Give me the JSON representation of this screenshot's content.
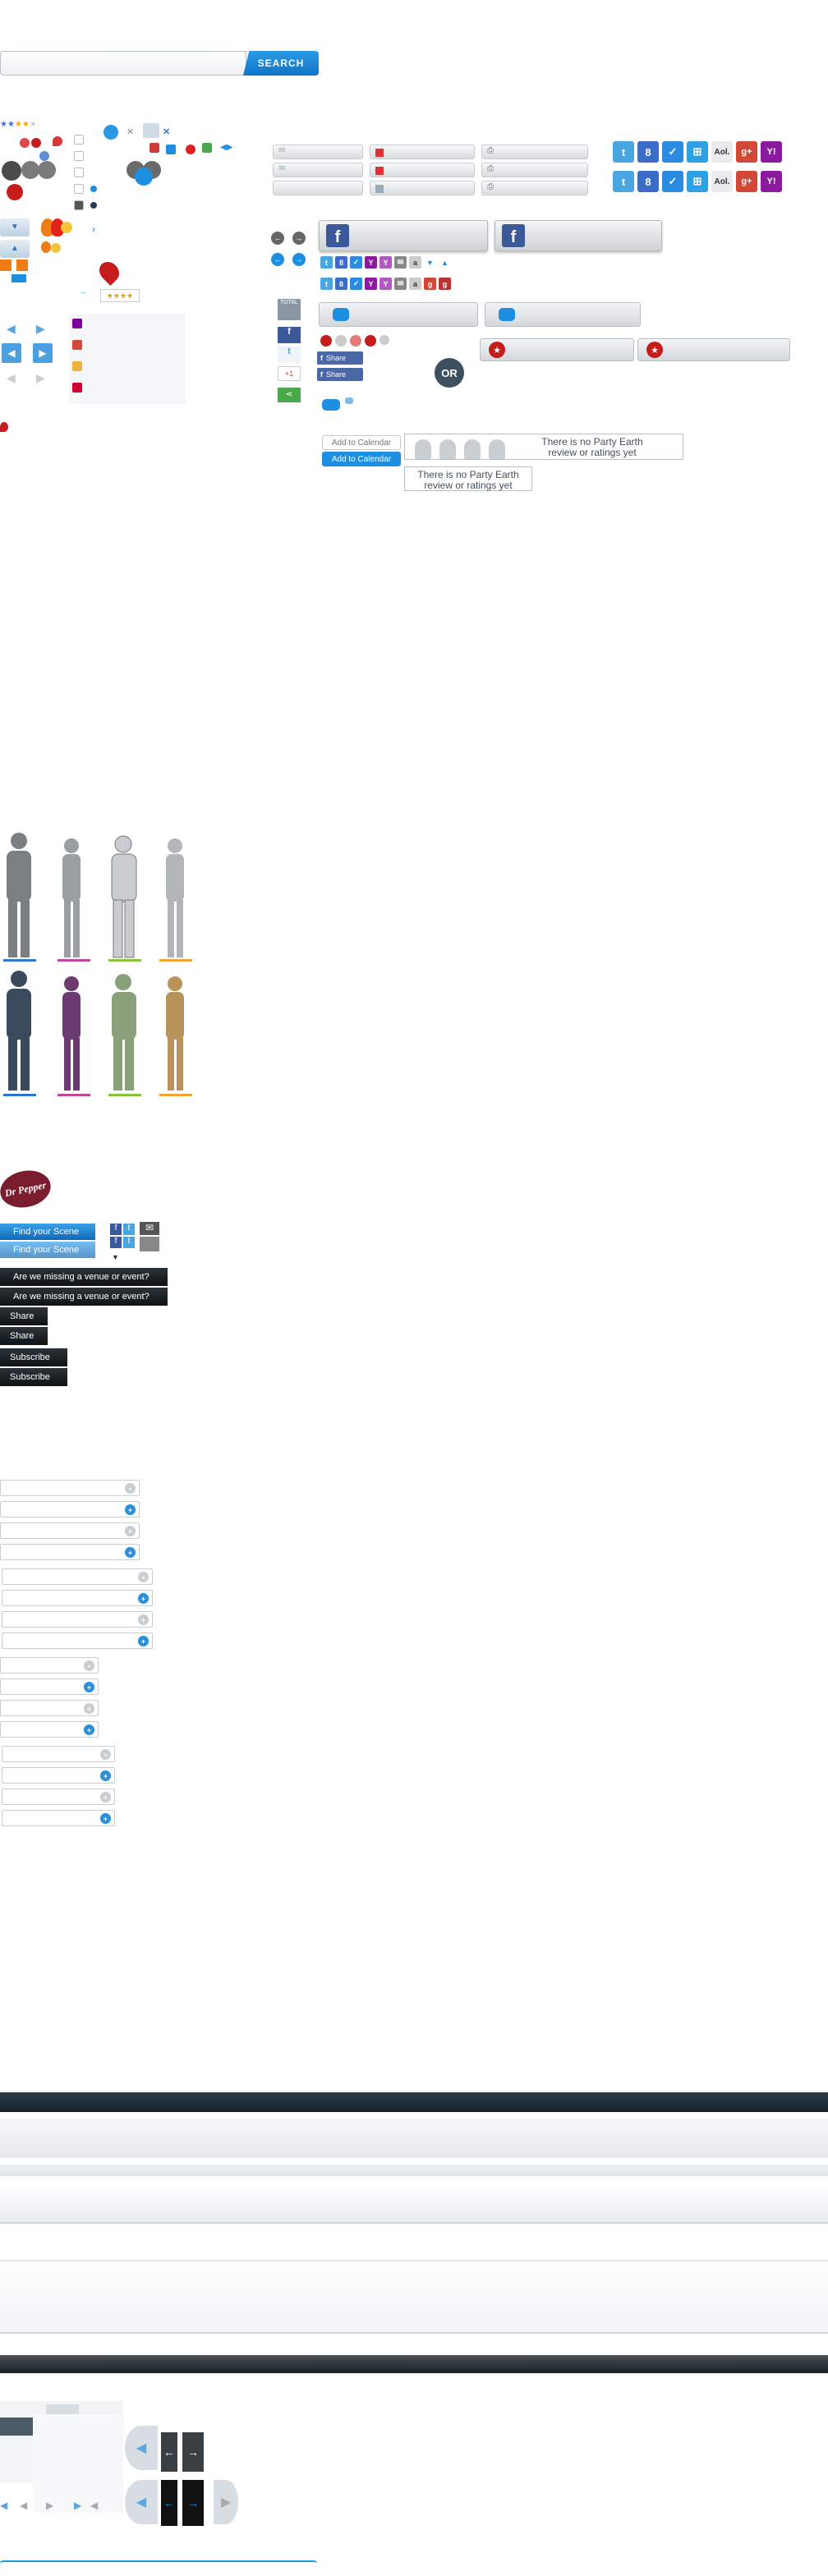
{
  "search": {
    "placeholder": "",
    "button_label": "SEARCH"
  },
  "colors": {
    "accent_blue": "#1e8fe0",
    "facebook": "#3b5998",
    "twitter": "#4aa6e0",
    "red": "#c51c1c",
    "green": "#49a84a",
    "dark": "#1f2a32"
  },
  "rating": {
    "stars_filled": 4,
    "stars_total": 5
  },
  "social": {
    "aol_label": "Aol.",
    "yahoo_label": "Y!",
    "google_plus_label": "g+",
    "facebook_letter": "f",
    "google_letter": "8",
    "twitter_letter": "t",
    "windows_label": "⊞"
  },
  "share": {
    "total_label": "TOTAL",
    "share_label": "Share",
    "gplus_label": "+1"
  },
  "or_label": "OR",
  "calendar": {
    "add_label": "Add to Calendar",
    "add_label_active": "Add to Calendar"
  },
  "messages": {
    "no_review_1": "There is no Party Earth review or ratings yet",
    "no_review_2": "There is no Party Earth review or ratings yet"
  },
  "brand": {
    "logo_text": "Dr Pepper"
  },
  "scene": {
    "find_label": "Find your Scene",
    "find_label_2": "Find your Scene"
  },
  "dark_buttons": {
    "missing_1": "Are we missing a venue or event?",
    "missing_2": "Are we missing a venue or event?",
    "share_1": "Share",
    "share_2": "Share",
    "subscribe_1": "Subscribe",
    "subscribe_2": "Subscribe"
  },
  "nav_arrows": {
    "left": "←",
    "right": "→",
    "prev": "◀",
    "next": "▶"
  }
}
